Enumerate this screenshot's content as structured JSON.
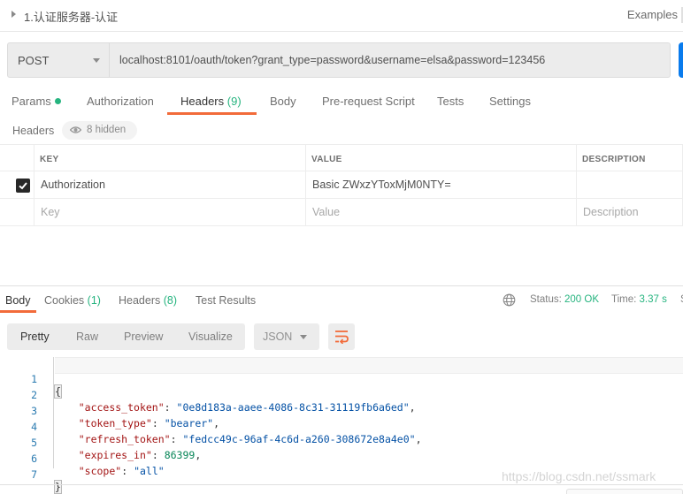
{
  "request": {
    "title": "1.认证服务器-认证",
    "examples_label": "Examples",
    "method": "POST",
    "url": "localhost:8101/oauth/token?grant_type=password&username=elsa&password=123456"
  },
  "request_tabs": [
    {
      "label": "Params",
      "has_dot": true
    },
    {
      "label": "Authorization"
    },
    {
      "label": "Headers",
      "count": "(9)",
      "active": true
    },
    {
      "label": "Body"
    },
    {
      "label": "Pre-request Script"
    },
    {
      "label": "Tests"
    },
    {
      "label": "Settings"
    }
  ],
  "headers_section": {
    "label": "Headers",
    "hidden_label": "8 hidden",
    "columns": [
      "KEY",
      "VALUE",
      "DESCRIPTION"
    ],
    "rows": [
      {
        "checked": true,
        "key": "Authorization",
        "value": "Basic ZWxzYToxMjM0NTY=",
        "description": ""
      }
    ],
    "placeholders": {
      "key": "Key",
      "value": "Value",
      "description": "Description"
    }
  },
  "response_tabs": [
    {
      "label": "Body",
      "active": true
    },
    {
      "label": "Cookies",
      "count": "(1)"
    },
    {
      "label": "Headers",
      "count": "(8)"
    },
    {
      "label": "Test Results"
    }
  ],
  "response_status": {
    "status_label": "Status:",
    "status_value": "200 OK",
    "time_label": "Time:",
    "time_value": "3.37 s",
    "size_label_partial": "S"
  },
  "body_toolbar": {
    "modes": [
      "Pretty",
      "Raw",
      "Preview",
      "Visualize"
    ],
    "active_mode": "Pretty",
    "format": "JSON"
  },
  "response_body": {
    "lines": [
      {
        "n": "1",
        "text": "{"
      },
      {
        "n": "2",
        "key": "access_token",
        "value": "0e8d183a-aaee-4086-8c31-31119fb6a6ed",
        "type": "string",
        "comma": true
      },
      {
        "n": "3",
        "key": "token_type",
        "value": "bearer",
        "type": "string",
        "comma": true
      },
      {
        "n": "4",
        "key": "refresh_token",
        "value": "fedcc49c-96af-4c6d-a260-308672e8a4e0",
        "type": "string",
        "comma": true
      },
      {
        "n": "5",
        "key": "expires_in",
        "value": "86399",
        "type": "number",
        "comma": true
      },
      {
        "n": "6",
        "key": "scope",
        "value": "all",
        "type": "string",
        "comma": false
      },
      {
        "n": "7",
        "text": "}"
      }
    ]
  },
  "watermark": "https://blog.csdn.net/ssmark",
  "colors": {
    "accent": "#f26b3a",
    "success": "#26b47f",
    "send_button": "#097bed"
  }
}
